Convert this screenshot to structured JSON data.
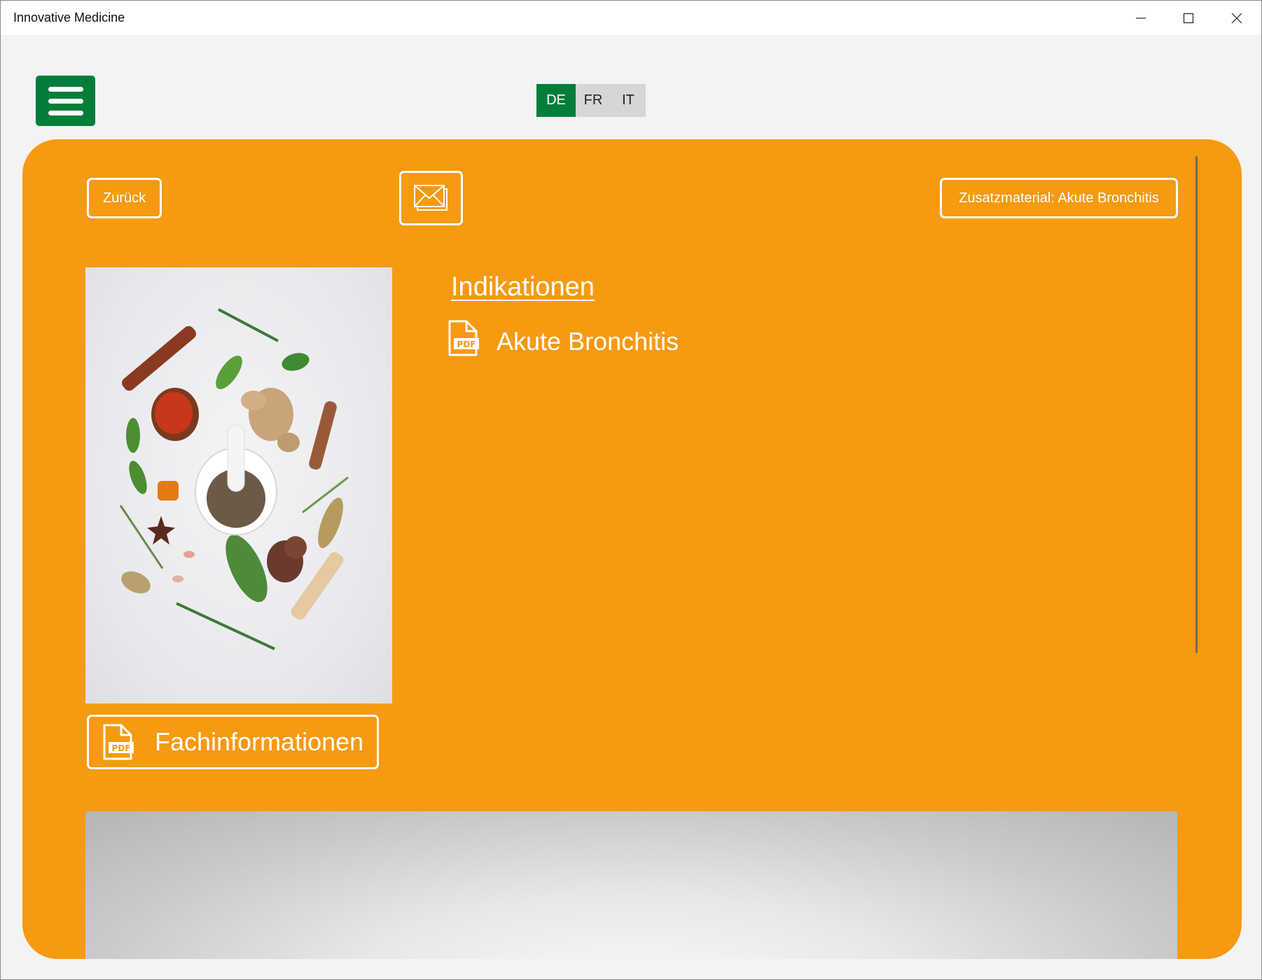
{
  "window": {
    "title": "Innovative Medicine",
    "controls": {
      "minimize": "minimize-icon",
      "maximize": "maximize-icon",
      "close": "close-icon"
    }
  },
  "menu": {
    "icon": "hamburger-menu-icon"
  },
  "languages": [
    {
      "code": "DE",
      "active": true
    },
    {
      "code": "FR",
      "active": false
    },
    {
      "code": "IT",
      "active": false
    }
  ],
  "toolbar": {
    "back_label": "Zurück",
    "mail_icon": "mail-icon",
    "extra_label": "Zusatzmaterial: Akute Bronchitis"
  },
  "content": {
    "heading": "Indikationen",
    "indications": [
      {
        "label": "Akute Bronchitis",
        "icon": "pdf-icon"
      }
    ],
    "fach_button_label": "Fachinformationen"
  },
  "colors": {
    "accent_green": "#037e3a",
    "panel_orange": "#f69a12",
    "background": "#f3f3f3",
    "text_on_panel": "#ffffff"
  }
}
